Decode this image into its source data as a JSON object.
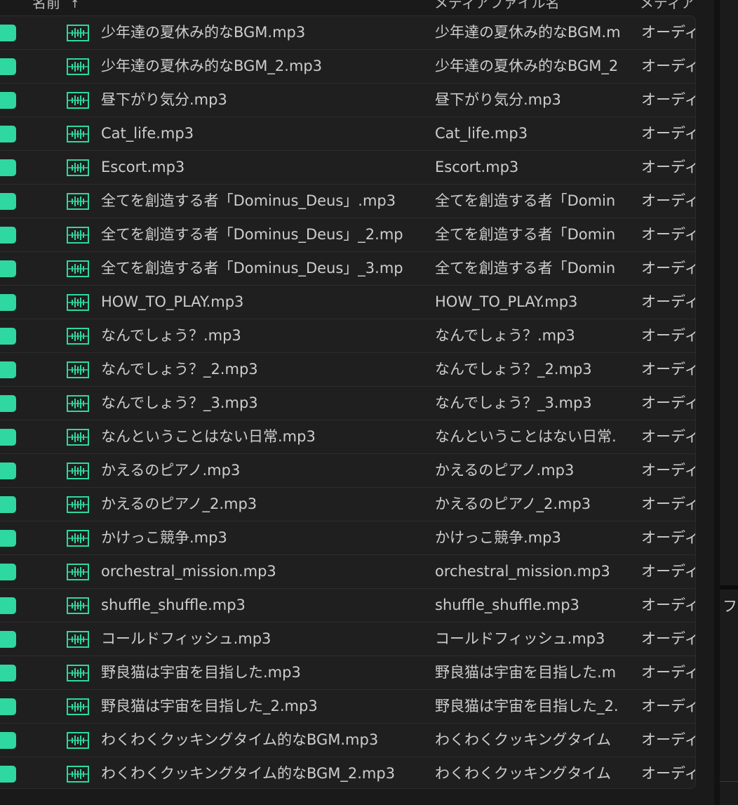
{
  "header": {
    "name_label": "名前",
    "sort_arrow": "↑",
    "media_label": "メディアファイル名",
    "type_label": "メディア"
  },
  "colors": {
    "label_green": "#2ed8a0",
    "icon_green": "#2ed8a0"
  },
  "file_icon": "audio-waveform-icon",
  "rows": [
    {
      "name": "少年達の夏休み的なBGM.mp3",
      "media": "少年達の夏休み的なBGM.m",
      "type": "オーディ"
    },
    {
      "name": "少年達の夏休み的なBGM_2.mp3",
      "media": "少年達の夏休み的なBGM_2",
      "type": "オーディ"
    },
    {
      "name": "昼下がり気分.mp3",
      "media": "昼下がり気分.mp3",
      "type": "オーディ"
    },
    {
      "name": "Cat_life.mp3",
      "media": "Cat_life.mp3",
      "type": "オーディ"
    },
    {
      "name": "Escort.mp3",
      "media": "Escort.mp3",
      "type": "オーディ"
    },
    {
      "name": "全てを創造する者「Dominus_Deus」.mp3",
      "media": "全てを創造する者「Domin",
      "type": "オーディ"
    },
    {
      "name": "全てを創造する者「Dominus_Deus」_2.mp",
      "media": "全てを創造する者「Domin",
      "type": "オーディ"
    },
    {
      "name": "全てを創造する者「Dominus_Deus」_3.mp",
      "media": "全てを創造する者「Domin",
      "type": "オーディ"
    },
    {
      "name": "HOW_TO_PLAY.mp3",
      "media": "HOW_TO_PLAY.mp3",
      "type": "オーディ"
    },
    {
      "name": "なんでしょう？.mp3",
      "media": "なんでしょう？.mp3",
      "type": "オーディ"
    },
    {
      "name": "なんでしょう？_2.mp3",
      "media": "なんでしょう？_2.mp3",
      "type": "オーディ"
    },
    {
      "name": "なんでしょう？_3.mp3",
      "media": "なんでしょう？_3.mp3",
      "type": "オーディ"
    },
    {
      "name": "なんということはない日常.mp3",
      "media": "なんということはない日常.",
      "type": "オーディ"
    },
    {
      "name": "かえるのピアノ.mp3",
      "media": "かえるのピアノ.mp3",
      "type": "オーディ"
    },
    {
      "name": "かえるのピアノ_2.mp3",
      "media": "かえるのピアノ_2.mp3",
      "type": "オーディ"
    },
    {
      "name": "かけっこ競争.mp3",
      "media": "かけっこ競争.mp3",
      "type": "オーディ"
    },
    {
      "name": "orchestral_mission.mp3",
      "media": "orchestral_mission.mp3",
      "type": "オーディ"
    },
    {
      "name": "shuffle_shuffle.mp3",
      "media": "shuffle_shuffle.mp3",
      "type": "オーディ"
    },
    {
      "name": "コールドフィッシュ.mp3",
      "media": "コールドフィッシュ.mp3",
      "type": "オーディ"
    },
    {
      "name": "野良猫は宇宙を目指した.mp3",
      "media": "野良猫は宇宙を目指した.m",
      "type": "オーディ"
    },
    {
      "name": "野良猫は宇宙を目指した_2.mp3",
      "media": "野良猫は宇宙を目指した_2.",
      "type": "オーディ"
    },
    {
      "name": "わくわくクッキングタイム的なBGM.mp3",
      "media": "わくわくクッキングタイム",
      "type": "オーディ"
    },
    {
      "name": "わくわくクッキングタイム的なBGM_2.mp3",
      "media": "わくわくクッキングタイム",
      "type": "オーディ"
    }
  ],
  "right_panel": {
    "text": "フ"
  }
}
